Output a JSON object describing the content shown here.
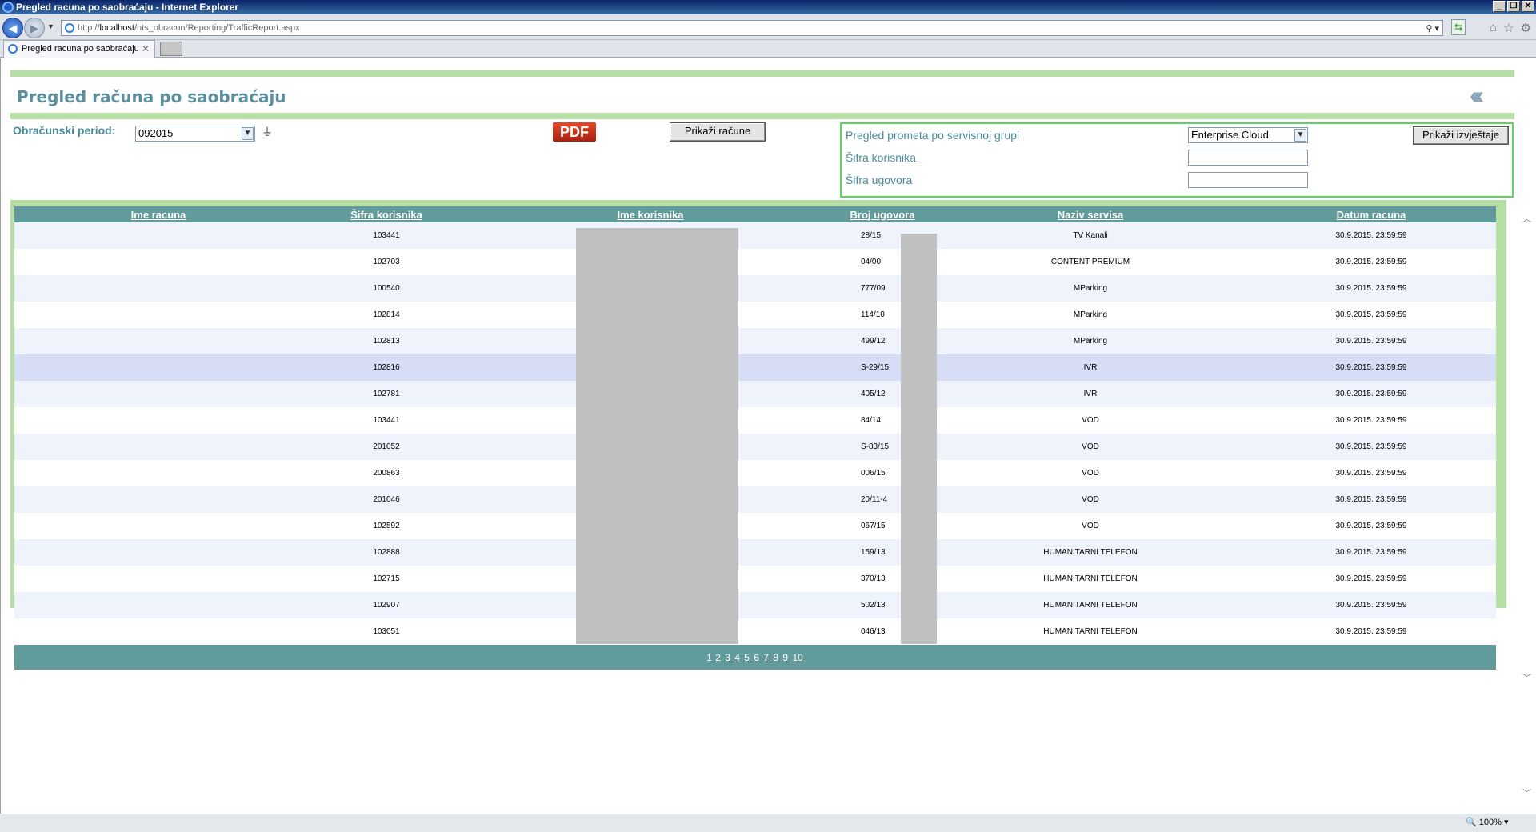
{
  "window": {
    "title": "Pregled racuna po saobraćaju - Internet Explorer"
  },
  "browser": {
    "url_prefix": "http://",
    "url_host": "localhost",
    "url_path": "/nts_obracun/Reporting/TrafficReport.aspx",
    "tab_label": "Pregled racuna po saobraćaju",
    "zoom": "100%"
  },
  "page": {
    "title": "Pregled računa po saobraćaju",
    "period_label": "Obračunski period:",
    "period_value": "092015",
    "pdf_label": "PDF",
    "show_invoices_button": "Prikaži račune",
    "panel": {
      "service_group_label": "Pregled prometa po servisnoj grupi",
      "service_group_value": "Enterprise Cloud",
      "customer_code_label": "Šifra korisnika",
      "contract_code_label": "Šifra ugovora",
      "show_reports_button": "Prikaži izvještaje"
    }
  },
  "grid": {
    "columns": [
      "Ime racuna",
      "Šifra korisnika",
      "Ime korisnika",
      "Broj ugovora",
      "Naziv servisa",
      "Datum racuna"
    ],
    "rows": [
      {
        "ime": "",
        "sifra": "103441",
        "korisnik": "",
        "ugovor": "28/15",
        "servis": "TV Kanali",
        "datum": "30.9.2015. 23:59:59"
      },
      {
        "ime": "",
        "sifra": "102703",
        "korisnik": "",
        "ugovor": "04/00",
        "servis": "CONTENT PREMIUM",
        "datum": "30.9.2015. 23:59:59"
      },
      {
        "ime": "",
        "sifra": "100540",
        "korisnik": "",
        "ugovor": "777/09",
        "servis": "MParking",
        "datum": "30.9.2015. 23:59:59"
      },
      {
        "ime": "",
        "sifra": "102814",
        "korisnik": "",
        "ugovor": "114/10",
        "servis": "MParking",
        "datum": "30.9.2015. 23:59:59"
      },
      {
        "ime": "",
        "sifra": "102813",
        "korisnik": "",
        "ugovor": "499/12",
        "servis": "MParking",
        "datum": "30.9.2015. 23:59:59"
      },
      {
        "ime": "",
        "sifra": "102816",
        "korisnik": "",
        "ugovor": "S-29/15",
        "servis": "IVR",
        "datum": "30.9.2015. 23:59:59"
      },
      {
        "ime": "",
        "sifra": "102781",
        "korisnik": "",
        "ugovor": "405/12",
        "servis": "IVR",
        "datum": "30.9.2015. 23:59:59"
      },
      {
        "ime": "",
        "sifra": "103441",
        "korisnik": "",
        "ugovor": "84/14",
        "servis": "VOD",
        "datum": "30.9.2015. 23:59:59"
      },
      {
        "ime": "",
        "sifra": "201052",
        "korisnik": "",
        "ugovor": "S-83/15",
        "servis": "VOD",
        "datum": "30.9.2015. 23:59:59"
      },
      {
        "ime": "",
        "sifra": "200863",
        "korisnik": "",
        "ugovor": "006/15",
        "servis": "VOD",
        "datum": "30.9.2015. 23:59:59"
      },
      {
        "ime": "",
        "sifra": "201046",
        "korisnik": "",
        "ugovor": "20/11-4",
        "servis": "VOD",
        "datum": "30.9.2015. 23:59:59"
      },
      {
        "ime": "",
        "sifra": "102592",
        "korisnik": "",
        "ugovor": "067/15",
        "servis": "VOD",
        "datum": "30.9.2015. 23:59:59"
      },
      {
        "ime": "",
        "sifra": "102888",
        "korisnik": "",
        "ugovor": "159/13",
        "servis": "HUMANITARNI TELEFON",
        "datum": "30.9.2015. 23:59:59"
      },
      {
        "ime": "",
        "sifra": "102715",
        "korisnik": "",
        "ugovor": "370/13",
        "servis": "HUMANITARNI TELEFON",
        "datum": "30.9.2015. 23:59:59"
      },
      {
        "ime": "",
        "sifra": "102907",
        "korisnik": "",
        "ugovor": "502/13",
        "servis": "HUMANITARNI TELEFON",
        "datum": "30.9.2015. 23:59:59"
      },
      {
        "ime": "",
        "sifra": "103051",
        "korisnik": "",
        "ugovor": "046/13",
        "servis": "HUMANITARNI TELEFON",
        "datum": "30.9.2015. 23:59:59"
      }
    ],
    "selected_row": 5,
    "pager": {
      "current": "1",
      "pages": [
        "2",
        "3",
        "4",
        "5",
        "6",
        "7",
        "8",
        "9",
        "10"
      ]
    }
  },
  "colors": {
    "accent_green": "#b7dfa5",
    "header_teal": "#629b9c",
    "title_teal": "#5a8fa0",
    "panel_border": "#5ad65a"
  }
}
